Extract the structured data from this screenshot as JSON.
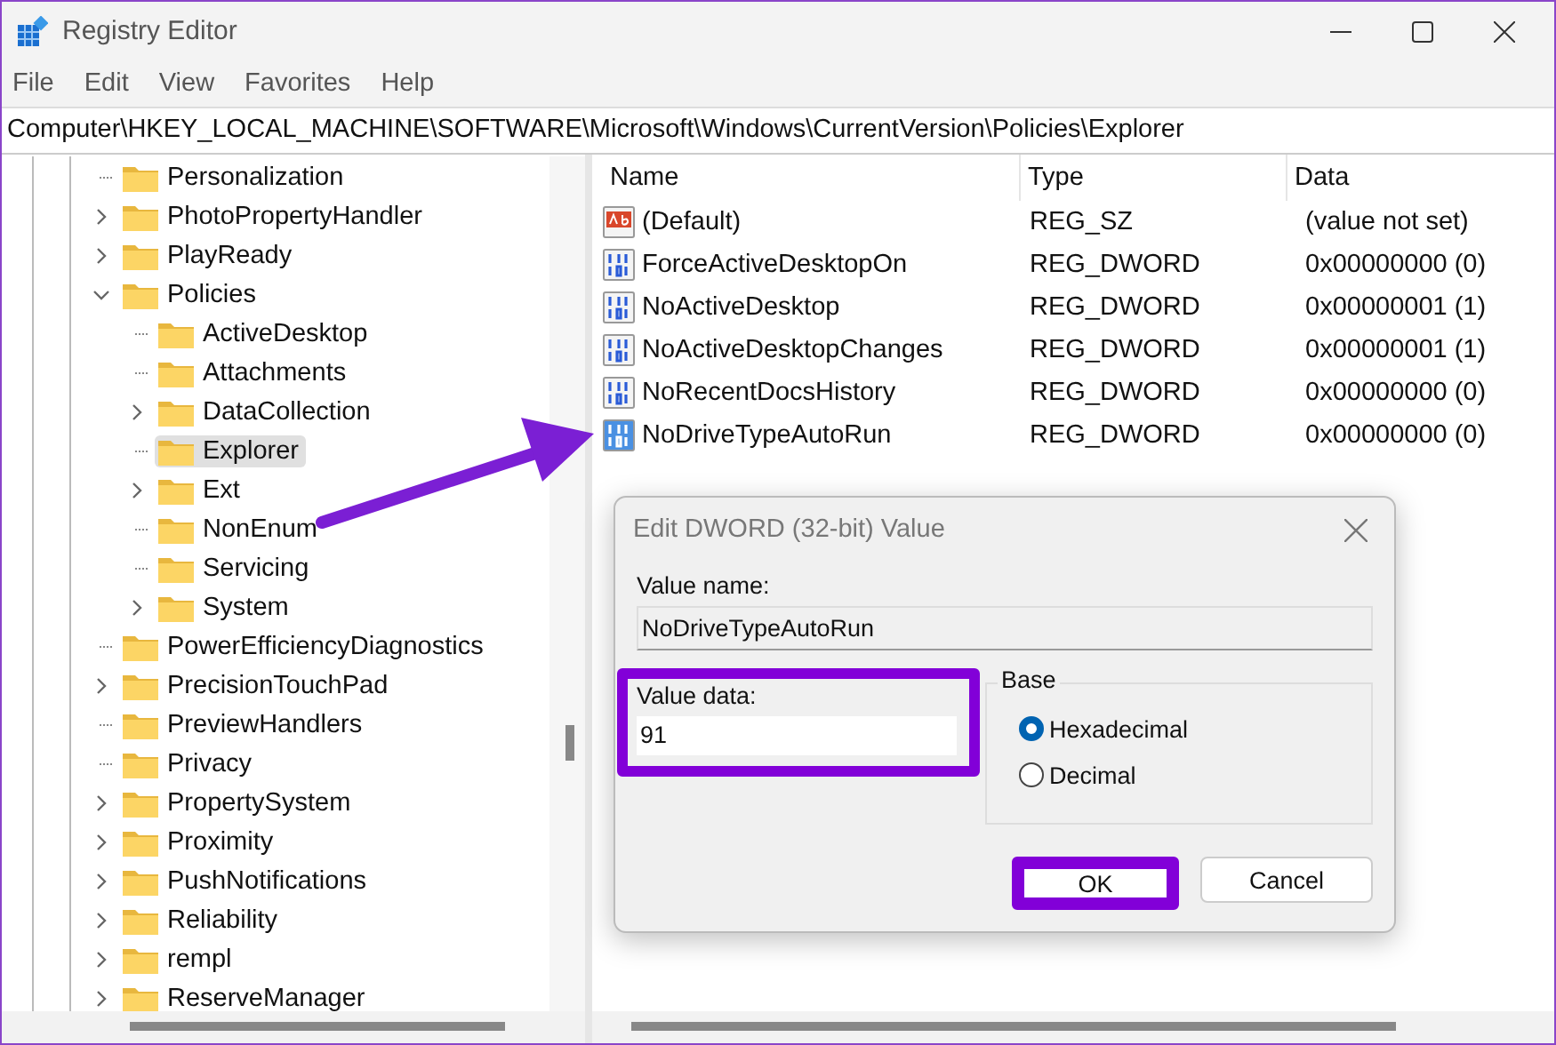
{
  "window": {
    "title": "Registry Editor"
  },
  "menu": [
    "File",
    "Edit",
    "View",
    "Favorites",
    "Help"
  ],
  "address": "Computer\\HKEY_LOCAL_MACHINE\\SOFTWARE\\Microsoft\\Windows\\CurrentVersion\\Policies\\Explorer",
  "tree": [
    {
      "label": "Personalization",
      "kind": "leaf",
      "selected": false
    },
    {
      "label": "PhotoPropertyHandler",
      "kind": "branch",
      "expanded": false,
      "selected": false
    },
    {
      "label": "PlayReady",
      "kind": "branch",
      "expanded": false,
      "selected": false
    },
    {
      "label": "Policies",
      "kind": "branch",
      "expanded": true,
      "selected": false,
      "children": [
        {
          "label": "ActiveDesktop",
          "kind": "leaf",
          "selected": false
        },
        {
          "label": "Attachments",
          "kind": "leaf",
          "selected": false
        },
        {
          "label": "DataCollection",
          "kind": "branch",
          "expanded": false,
          "selected": false
        },
        {
          "label": "Explorer",
          "kind": "leaf",
          "selected": true
        },
        {
          "label": "Ext",
          "kind": "branch",
          "expanded": false,
          "selected": false
        },
        {
          "label": "NonEnum",
          "kind": "leaf",
          "selected": false
        },
        {
          "label": "Servicing",
          "kind": "leaf",
          "selected": false
        },
        {
          "label": "System",
          "kind": "branch",
          "expanded": false,
          "selected": false
        }
      ]
    },
    {
      "label": "PowerEfficiencyDiagnostics",
      "kind": "leaf",
      "selected": false
    },
    {
      "label": "PrecisionTouchPad",
      "kind": "branch",
      "expanded": false,
      "selected": false
    },
    {
      "label": "PreviewHandlers",
      "kind": "leaf",
      "selected": false
    },
    {
      "label": "Privacy",
      "kind": "leaf",
      "selected": false
    },
    {
      "label": "PropertySystem",
      "kind": "branch",
      "expanded": false,
      "selected": false
    },
    {
      "label": "Proximity",
      "kind": "branch",
      "expanded": false,
      "selected": false
    },
    {
      "label": "PushNotifications",
      "kind": "branch",
      "expanded": false,
      "selected": false
    },
    {
      "label": "Reliability",
      "kind": "branch",
      "expanded": false,
      "selected": false
    },
    {
      "label": "rempl",
      "kind": "branch",
      "expanded": false,
      "selected": false
    },
    {
      "label": "ReserveManager",
      "kind": "branch",
      "expanded": false,
      "selected": false
    }
  ],
  "values": {
    "columns": [
      "Name",
      "Type",
      "Data"
    ],
    "rows": [
      {
        "kind": "string",
        "name": "(Default)",
        "type": "REG_SZ",
        "data": "(value not set)",
        "selected": false
      },
      {
        "kind": "binary",
        "name": "ForceActiveDesktopOn",
        "type": "REG_DWORD",
        "data": "0x00000000 (0)",
        "selected": false
      },
      {
        "kind": "binary",
        "name": "NoActiveDesktop",
        "type": "REG_DWORD",
        "data": "0x00000001 (1)",
        "selected": false
      },
      {
        "kind": "binary",
        "name": "NoActiveDesktopChanges",
        "type": "REG_DWORD",
        "data": "0x00000001 (1)",
        "selected": false
      },
      {
        "kind": "binary",
        "name": "NoRecentDocsHistory",
        "type": "REG_DWORD",
        "data": "0x00000000 (0)",
        "selected": false
      },
      {
        "kind": "binary",
        "name": "NoDriveTypeAutoRun",
        "type": "REG_DWORD",
        "data": "0x00000000 (0)",
        "selected": true
      }
    ]
  },
  "dialog": {
    "title": "Edit DWORD (32-bit) Value",
    "value_name_label": "Value name:",
    "value_name": "NoDriveTypeAutoRun",
    "value_data_label": "Value data:",
    "value_data": "91",
    "base_label": "Base",
    "bases": [
      {
        "label": "Hexadecimal",
        "selected": true
      },
      {
        "label": "Decimal",
        "selected": false
      }
    ],
    "buttons": [
      {
        "label": "OK",
        "kind": "primary"
      },
      {
        "label": "Cancel",
        "kind": "secondary"
      }
    ]
  }
}
